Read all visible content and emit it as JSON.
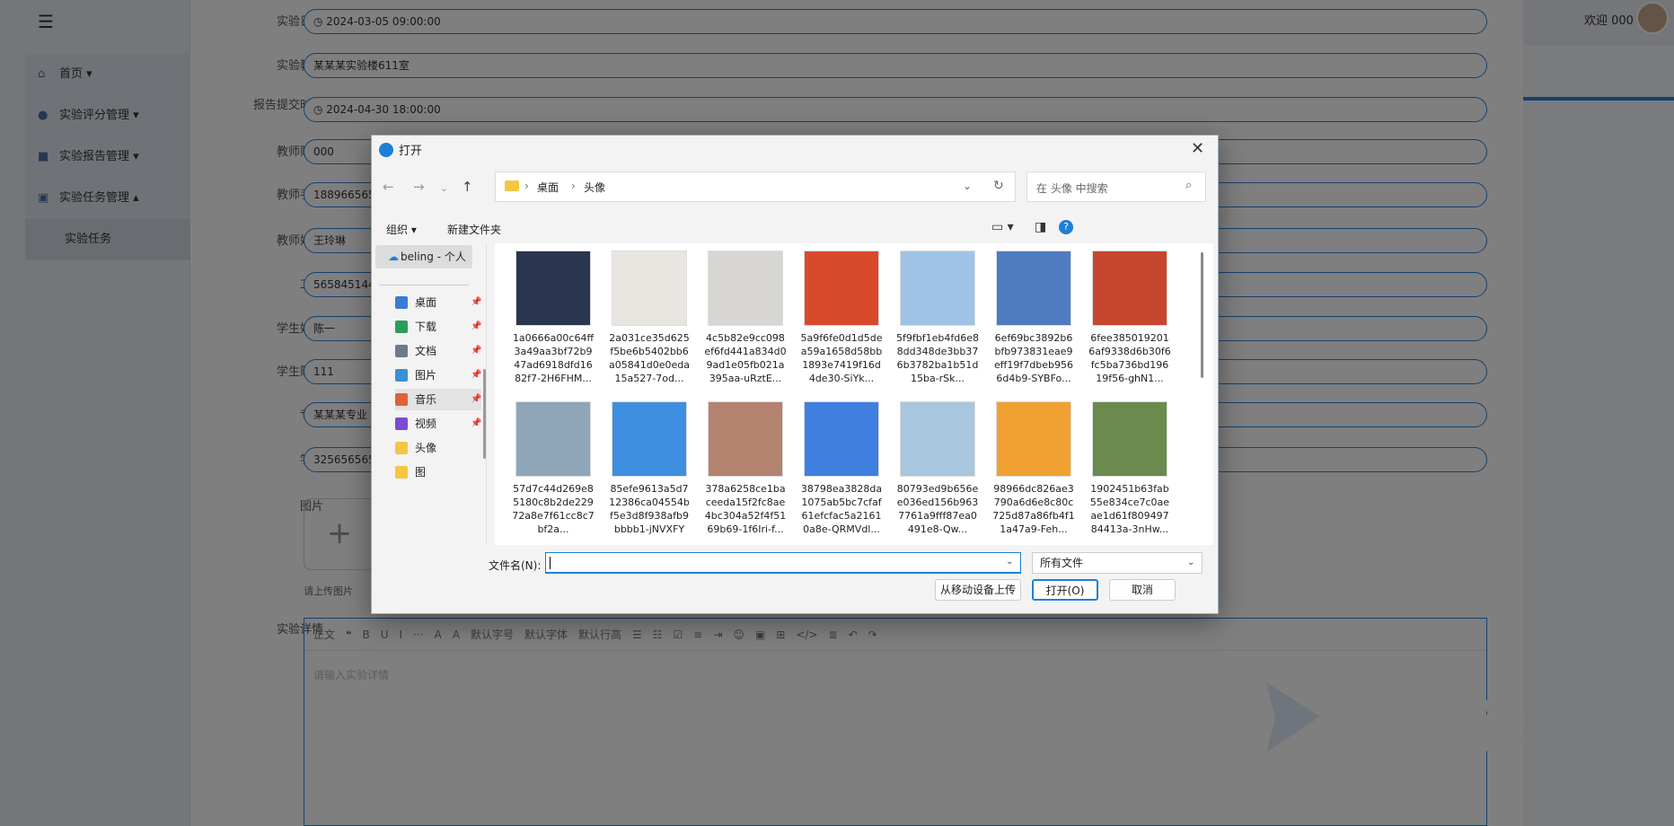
{
  "sidebar": {
    "items": [
      {
        "label": "首页",
        "icon": "home-icon"
      },
      {
        "label": "实验评分管理",
        "icon": "score-icon"
      },
      {
        "label": "实验报告管理",
        "icon": "report-icon"
      },
      {
        "label": "实验任务管理",
        "icon": "task-icon"
      }
    ],
    "subitem": "实验任务"
  },
  "topbar": {
    "welcome": "欢迎 000"
  },
  "form": {
    "rows": [
      {
        "label": "实验日期",
        "value": "◷  2024-03-05 09:00:00"
      },
      {
        "label": "实验教室",
        "value": "某某某实验楼611室"
      },
      {
        "label": "报告提交时间",
        "value": "◷  2024-04-30 18:00:00"
      },
      {
        "label": "教师账号",
        "value": "000"
      },
      {
        "label": "教师手机",
        "value": "1889665656"
      },
      {
        "label": "教师姓名",
        "value": "王玲琳"
      },
      {
        "label": "工号",
        "value": "5658451445"
      },
      {
        "label": "学生姓名",
        "value": "陈一"
      },
      {
        "label": "学生账号",
        "value": "111"
      },
      {
        "label": "专业",
        "value": "某某某专业"
      },
      {
        "label": "学号",
        "value": "3256565656"
      }
    ],
    "image_label": "图片",
    "upload_hint": "请上传图片",
    "detail_label": "实验详情",
    "editor_placeholder": "请输入实验详情",
    "toolbar": [
      "正文",
      "❝",
      "B",
      "U",
      "I",
      "···",
      "A",
      "A",
      "默认字号",
      "默认字体",
      "默认行高",
      "☰",
      "☷",
      "☑",
      "≡",
      "⇥",
      "☺",
      "▣",
      "⊞",
      "</>",
      "≣",
      "↶",
      "↷"
    ]
  },
  "watermark_text": "辑",
  "dialog": {
    "title": "打开",
    "path": [
      "桌面",
      "头像"
    ],
    "search_placeholder": "在 头像 中搜索",
    "organize": "组织 ▾",
    "new_folder": "新建文件夹",
    "cloud": "beling - 个人",
    "nav": [
      {
        "label": "桌面",
        "color": "#3a7bd5",
        "pinned": true
      },
      {
        "label": "下载",
        "color": "#2a9d5c",
        "pinned": true
      },
      {
        "label": "文档",
        "color": "#6d7a8a",
        "pinned": true
      },
      {
        "label": "图片",
        "color": "#3a8fd5",
        "pinned": true
      },
      {
        "label": "音乐",
        "color": "#e0603a",
        "pinned": true
      },
      {
        "label": "视频",
        "color": "#7b4bd0",
        "pinned": true
      },
      {
        "label": "头像",
        "color": "#f4c642",
        "pinned": false
      },
      {
        "label": "图",
        "color": "#f4c642",
        "pinned": false
      }
    ],
    "files": [
      {
        "name": "1a0666a00c64ff3a49aa3bf72b947ad6918dfd1682f7-2H6FHM...",
        "bg": "#2a3550"
      },
      {
        "name": "2a031ce35d625f5be6b5402bb6a05841d0e0eda15a527-7od...",
        "bg": "#e9e6e1"
      },
      {
        "name": "4c5b82e9cc098ef6fd441a834d09ad1e05fb021a395aa-uRztE...",
        "bg": "#d8d6d2"
      },
      {
        "name": "5a9f6fe0d1d5dea59a1658d58bb1893e7419f16d4de30-SiYk...",
        "bg": "#d94a2c"
      },
      {
        "name": "5f9fbf1eb4fd6e88dd348de3bb376b3782ba1b51d15ba-rSk...",
        "bg": "#9fc3e6"
      },
      {
        "name": "6ef69bc3892b6bfb973831eae9eff19f7dbeb9566d4b9-SYBFo...",
        "bg": "#4f7cc0"
      },
      {
        "name": "6fee3850192016af9338d6b30f6fc5ba736bd19619f56-ghN1...",
        "bg": "#c7462e"
      },
      {
        "name": "57d7c44d269e85180c8b2de22972a8e7f61cc8c7bf2a...",
        "bg": "#8fa6b8"
      },
      {
        "name": "85efe9613a5d712386ca04554bf5e3d8f938afb9bbbb1-jNVXFY",
        "bg": "#3f8fe0"
      },
      {
        "name": "378a6258ce1baceeda15f2fc8ae4bc304a52f4f5169b69-1f6Iri-f...",
        "bg": "#b3836f"
      },
      {
        "name": "38798ea3828da1075ab5bc7cfaf61efcfac5a21610a8e-QRMVdl...",
        "bg": "#3f7fe0"
      },
      {
        "name": "80793ed9b656ee036ed156b9637761a9fff87ea0491e8-Qw...",
        "bg": "#a9c6df"
      },
      {
        "name": "98966dc826ae3790a6d6e8c80c725d87a86fb4f11a47a9-Feh...",
        "bg": "#f0a132"
      },
      {
        "name": "1902451b63fab55e834ce7c0aeae1d61f80949784413a-3nHw...",
        "bg": "#6b8a4e"
      }
    ],
    "filename_label": "文件名(N):",
    "filename_value": "",
    "filetype": "所有文件",
    "upload_mobile": "从移动设备上传",
    "open": "打开(O)",
    "cancel": "取消"
  }
}
